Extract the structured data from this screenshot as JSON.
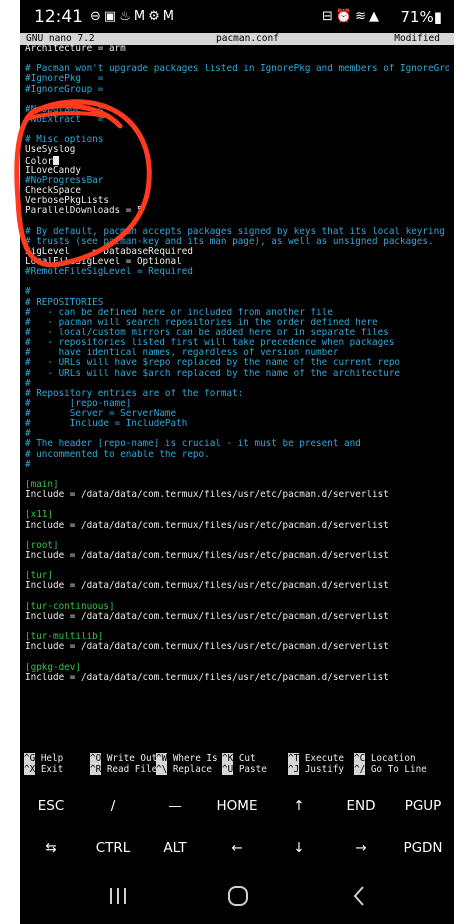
{
  "status_bar": {
    "time": "12:41",
    "battery": "71%"
  },
  "nano_header": {
    "version": "GNU nano 7.2",
    "filename": "pacman.conf",
    "state": "Modified"
  },
  "editor_lines": [
    {
      "text": "Architecture = arm",
      "style": "default"
    },
    {
      "text": "",
      "style": "default"
    },
    {
      "text": "# Pacman won't upgrade packages listed in IgnorePkg and members of IgnoreGroup",
      "style": "comment"
    },
    {
      "text": "#IgnorePkg   =",
      "style": "comment"
    },
    {
      "text": "#IgnoreGroup =",
      "style": "comment"
    },
    {
      "text": "",
      "style": "default"
    },
    {
      "text": "#NoUpgrade   =",
      "style": "comment"
    },
    {
      "text": "#NoExtract   =",
      "style": "comment"
    },
    {
      "text": "",
      "style": "default"
    },
    {
      "text": "# Misc options",
      "style": "comment"
    },
    {
      "text": "UseSyslog",
      "style": "default"
    },
    {
      "text": "Color",
      "style": "default",
      "cursor": true
    },
    {
      "text": "ILoveCandy",
      "style": "default"
    },
    {
      "text": "#NoProgressBar",
      "style": "comment"
    },
    {
      "text": "CheckSpace",
      "style": "default"
    },
    {
      "text": "VerbosePkgLists",
      "style": "default"
    },
    {
      "text": "ParallelDownloads = 5",
      "style": "default"
    },
    {
      "text": "",
      "style": "default"
    },
    {
      "text": "# By default, pacman accepts packages signed by keys that its local keyring",
      "style": "comment"
    },
    {
      "text": "# trusts (see pacman-key and its man page), as well as unsigned packages.",
      "style": "comment"
    },
    {
      "text": "SigLevel    = DatabaseRequired",
      "style": "default"
    },
    {
      "text": "LocalFileSigLevel = Optional",
      "style": "default"
    },
    {
      "text": "#RemoteFileSigLevel = Required",
      "style": "comment"
    },
    {
      "text": "",
      "style": "default"
    },
    {
      "text": "#",
      "style": "comment"
    },
    {
      "text": "# REPOSITORIES",
      "style": "comment"
    },
    {
      "text": "#   - can be defined here or included from another file",
      "style": "comment"
    },
    {
      "text": "#   - pacman will search repositories in the order defined here",
      "style": "comment"
    },
    {
      "text": "#   - local/custom mirrors can be added here or in separate files",
      "style": "comment"
    },
    {
      "text": "#   - repositories listed first will take precedence when packages",
      "style": "comment"
    },
    {
      "text": "#     have identical names, regardless of version number",
      "style": "comment"
    },
    {
      "text": "#   - URLs will have $repo replaced by the name of the current repo",
      "style": "comment"
    },
    {
      "text": "#   - URLs will have $arch replaced by the name of the architecture",
      "style": "comment"
    },
    {
      "text": "#",
      "style": "comment"
    },
    {
      "text": "# Repository entries are of the format:",
      "style": "comment"
    },
    {
      "text": "#       [repo-name]",
      "style": "comment"
    },
    {
      "text": "#       Server = ServerName",
      "style": "comment"
    },
    {
      "text": "#       Include = IncludePath",
      "style": "comment"
    },
    {
      "text": "#",
      "style": "comment"
    },
    {
      "text": "# The header [repo-name] is crucial - it must be present and",
      "style": "comment"
    },
    {
      "text": "# uncommented to enable the repo.",
      "style": "comment"
    },
    {
      "text": "#",
      "style": "comment"
    },
    {
      "text": "",
      "style": "default"
    },
    {
      "text": "[main]",
      "style": "section"
    },
    {
      "text": "Include = /data/data/com.termux/files/usr/etc/pacman.d/serverlist",
      "style": "default"
    },
    {
      "text": "",
      "style": "default"
    },
    {
      "text": "[x11]",
      "style": "section"
    },
    {
      "text": "Include = /data/data/com.termux/files/usr/etc/pacman.d/serverlist",
      "style": "default"
    },
    {
      "text": "",
      "style": "default"
    },
    {
      "text": "[root]",
      "style": "section"
    },
    {
      "text": "Include = /data/data/com.termux/files/usr/etc/pacman.d/serverlist",
      "style": "default"
    },
    {
      "text": "",
      "style": "default"
    },
    {
      "text": "[tur]",
      "style": "section"
    },
    {
      "text": "Include = /data/data/com.termux/files/usr/etc/pacman.d/serverlist",
      "style": "default"
    },
    {
      "text": "",
      "style": "default"
    },
    {
      "text": "[tur-continuous]",
      "style": "section"
    },
    {
      "text": "Include = /data/data/com.termux/files/usr/etc/pacman.d/serverlist",
      "style": "default"
    },
    {
      "text": "",
      "style": "default"
    },
    {
      "text": "[tur-multilib]",
      "style": "section"
    },
    {
      "text": "Include = /data/data/com.termux/files/usr/etc/pacman.d/serverlist",
      "style": "default"
    },
    {
      "text": "",
      "style": "default"
    },
    {
      "text": "[gpkg-dev]",
      "style": "section"
    },
    {
      "text": "Include = /data/data/com.termux/files/usr/etc/pacman.d/serverlist",
      "style": "default"
    }
  ],
  "shortcuts": [
    {
      "key": "^G",
      "label": "Help"
    },
    {
      "key": "^O",
      "label": "Write Out"
    },
    {
      "key": "^W",
      "label": "Where Is"
    },
    {
      "key": "^K",
      "label": "Cut"
    },
    {
      "key": "^T",
      "label": "Execute"
    },
    {
      "key": "^C",
      "label": "Location"
    },
    {
      "key": "^X",
      "label": "Exit"
    },
    {
      "key": "^R",
      "label": "Read File"
    },
    {
      "key": "^\\",
      "label": "Replace"
    },
    {
      "key": "^U",
      "label": "Paste"
    },
    {
      "key": "^J",
      "label": "Justify"
    },
    {
      "key": "^/",
      "label": "Go To Line"
    }
  ],
  "extra_keys": [
    {
      "label": "ESC",
      "icon": "esc-key"
    },
    {
      "label": "/",
      "icon": "slash-key"
    },
    {
      "label": "—",
      "icon": "dash-key"
    },
    {
      "label": "HOME",
      "icon": "home-key"
    },
    {
      "label": "↑",
      "icon": "arrow-up-icon"
    },
    {
      "label": "END",
      "icon": "end-key"
    },
    {
      "label": "PGUP",
      "icon": "pgup-key"
    },
    {
      "label": "⇆",
      "icon": "tab-icon"
    },
    {
      "label": "CTRL",
      "icon": "ctrl-key"
    },
    {
      "label": "ALT",
      "icon": "alt-key"
    },
    {
      "label": "←",
      "icon": "arrow-left-icon"
    },
    {
      "label": "↓",
      "icon": "arrow-down-icon"
    },
    {
      "label": "→",
      "icon": "arrow-right-icon"
    },
    {
      "label": "PGDN",
      "icon": "pgdn-key"
    }
  ],
  "colors": {
    "comment": "#2ea8d8",
    "section": "#31c244",
    "text": "#ececec",
    "header_bg": "#d6d6d6",
    "annotation": "#ff3a1e"
  }
}
